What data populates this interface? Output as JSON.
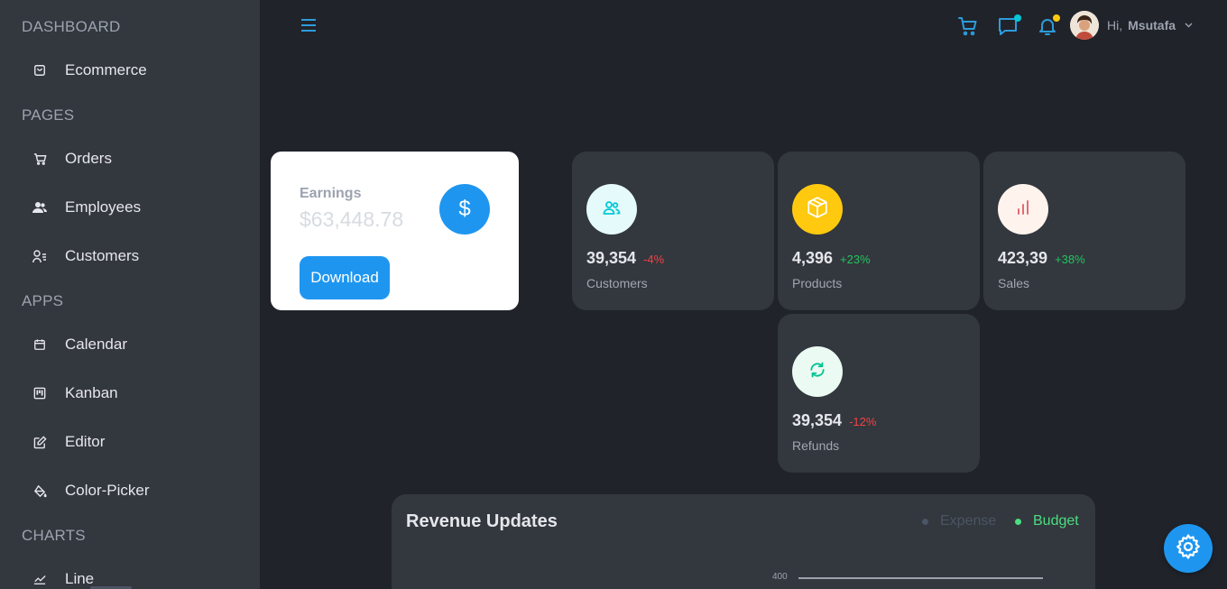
{
  "colors": {
    "accent": "#1e96f0",
    "icon_blue": "#2d9cdb",
    "positive": "#22c55e",
    "negative": "#ef4444",
    "budget": "#4ade80",
    "sidebar_bg": "#33373e",
    "main_bg": "#20232a",
    "card_bg": "#33373e"
  },
  "sidebar": {
    "sections": [
      {
        "label": "DASHBOARD",
        "items": [
          {
            "label": "Ecommerce",
            "icon": "shopping-bag-icon"
          }
        ]
      },
      {
        "label": "PAGES",
        "items": [
          {
            "label": "Orders",
            "icon": "cart-icon"
          },
          {
            "label": "Employees",
            "icon": "users-icon"
          },
          {
            "label": "Customers",
            "icon": "user-list-icon"
          }
        ]
      },
      {
        "label": "APPS",
        "items": [
          {
            "label": "Calendar",
            "icon": "calendar-icon"
          },
          {
            "label": "Kanban",
            "icon": "kanban-icon"
          },
          {
            "label": "Editor",
            "icon": "edit-icon"
          },
          {
            "label": "Color-Picker",
            "icon": "paint-bucket-icon"
          }
        ]
      },
      {
        "label": "CHARTS",
        "items": [
          {
            "label": "Line",
            "icon": "line-chart-icon"
          }
        ]
      }
    ]
  },
  "header": {
    "menu_icon": "hamburger-icon",
    "icons": [
      "cart-icon",
      "chat-icon",
      "bell-icon"
    ],
    "greeting": "Hi,",
    "username": "Msutafa"
  },
  "earnings": {
    "title": "Earnings",
    "amount": "$63,448.78",
    "button_label": "Download",
    "icon_glyph": "$"
  },
  "stats": [
    {
      "value": "39,354",
      "change": "-4%",
      "label": "Customers",
      "icon": "users-icon",
      "trend": "negative",
      "icon_bg": "#e5fafb",
      "icon_color": "#03c9d7"
    },
    {
      "value": "4,396",
      "change": "+23%",
      "label": "Products",
      "icon": "box-icon",
      "trend": "positive",
      "icon_bg": "#fec90f",
      "icon_color": "#ffffff"
    },
    {
      "value": "423,39",
      "change": "+38%",
      "label": "Sales",
      "icon": "bar-chart-icon",
      "trend": "positive",
      "icon_bg": "#fff4ed",
      "icon_color": "#e46a76"
    },
    {
      "value": "39,354",
      "change": "-12%",
      "label": "Refunds",
      "icon": "refresh-icon",
      "trend": "negative",
      "icon_bg": "#ebfaf2",
      "icon_color": "#00c292"
    }
  ],
  "revenue": {
    "title": "Revenue Updates",
    "legend": [
      {
        "label": "Expense",
        "color": "#4b5563"
      },
      {
        "label": "Budget",
        "color": "#4ade80"
      }
    ],
    "axis_tick": "400"
  }
}
